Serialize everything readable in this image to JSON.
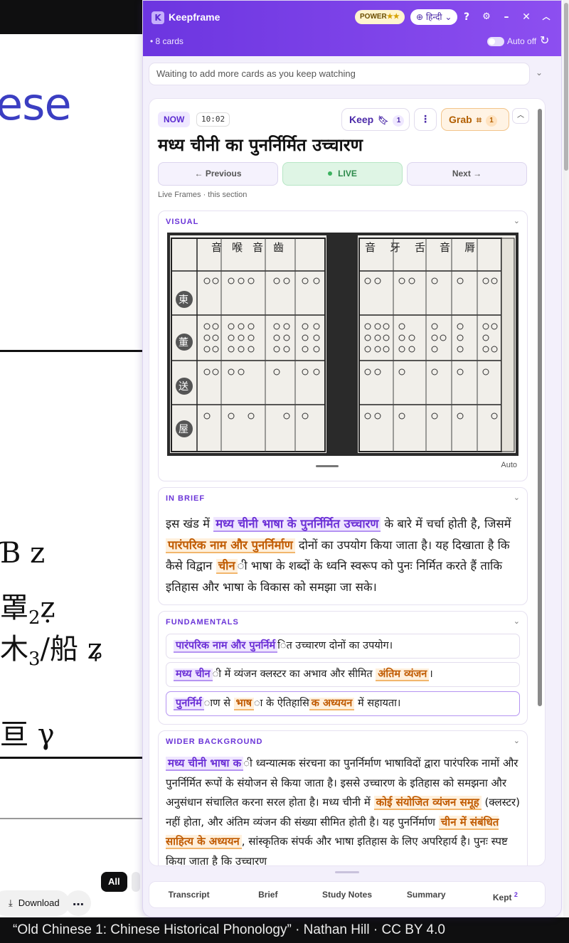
{
  "background": {
    "heading_fragment": "ese",
    "han_lines": [
      {
        "char": "Ɓ",
        "roman": "z"
      },
      {
        "char": "罩",
        "sub": "2",
        "roman": "ẓ"
      },
      {
        "char": "木",
        "sub": "3",
        "roman": "/船 ʑ"
      },
      {
        "char": "亘",
        "roman": "γ"
      }
    ],
    "chip_all": "All",
    "download_label": "Download",
    "caption": "“Old Chinese 1: Chinese Historical Phonology” · Nathan Hill · CC BY 4.0"
  },
  "header": {
    "logo_letter": "K",
    "brand": "Keepframe",
    "power_label": "POWER",
    "power_stars": "★★",
    "language": "⊕ हिन्दी ⌄",
    "cards_count": "• 8 cards",
    "auto_label": "Auto off"
  },
  "waiting_text": "Waiting to add more cards as you keep watching",
  "card": {
    "now_label": "NOW",
    "timestamp": "10:02",
    "keep_label": "Keep",
    "keep_count": "1",
    "grab_label": "Grab",
    "grab_count": "1",
    "title": "मध्य चीनी का पुनर्निर्मित उच्चारण",
    "prev_label": "← Previous",
    "live_label": "LIVE",
    "next_label": "Next →",
    "live_frames": "Live Frames · this section",
    "visual": {
      "label": "VISUAL",
      "auto": "Auto",
      "right_page_heads": [
        "音",
        "牙",
        "舌",
        "音",
        "脣"
      ],
      "left_page_heads": [
        "齒",
        "音",
        "喉",
        "音",
        "齒"
      ],
      "row_chars": [
        "東",
        "董",
        "送",
        "屋"
      ]
    },
    "brief": {
      "label": "IN BRIEF",
      "p1": "इस खंड में ",
      "h1": "मध्य चीनी भाषा के पुनर्निर्मित उच्चारण",
      "p2": " के बारे में चर्चा होती है, जिसमें ",
      "h2": "पारंपरिक नाम और पुनर्निर्माण",
      "p3": " दोनों का उपयोग किया जाता है। यह दिखाता है कि कैसे विद्वान ",
      "h3": "चीन",
      "p4": "ी भाषा के शब्दों के ध्वनि स्वरूप को पुनः निर्मित करते हैं ताकि इतिहास और भाषा के विकास को समझा जा सके।"
    },
    "fundamentals": {
      "label": "FUNDAMENTALS",
      "i1_h": "पारंपरिक नाम और पुनर्निर्म",
      "i1_t": "ित उच्चारण दोनों का उपयोग।",
      "i2_h": "मध्य चीन",
      "i2_t": "ी में व्यंजन क्लस्टर का अभाव और सीमित ",
      "i2_h2": "अंतिम व्यंजन",
      "i2_t2": "।",
      "i3_h": "पुनर्निर्म",
      "i3_t": "ाण से ",
      "i3_h2": "भाष",
      "i3_t2": "ा के ऐतिहासि",
      "i3_h3": "क अध्ययन",
      "i3_t3": " में सहायता।"
    },
    "wider": {
      "label": "WIDER BACKGROUND",
      "h1": "मध्य चीनी भाषा क",
      "t1": "ी ध्वन्यात्मक संरचना का पुनर्निर्माण भाषाविदों द्वारा पारंपरिक नामों और पुनर्निर्मित रूपों के संयोजन से किया जाता है। इससे उच्चारण के इतिहास को समझना और अनुसंधान संचालित करना सरल होता है। मध्य चीनी में ",
      "h2": "कोई संयोजित व्यंजन समूह",
      "t2": " (क्लस्टर) नहीं होता, और अंतिम व्यंजन की संख्या सीमित होती है। यह पुनर्निर्माण ",
      "h3": "चीन में संबंधित साहित्य के अध्ययन",
      "t3": ", सांस्कृतिक संपर्क और भाषा इतिहास के लिए अपरिहार्य है। पुनः स्पष्ट किया जाता है कि उच्चारण"
    }
  },
  "tabs": {
    "transcript": "Transcript",
    "brief": "Brief",
    "study_notes": "Study Notes",
    "summary": "Summary",
    "kept": "Kept",
    "kept_count": "2"
  },
  "colors": {
    "header_start": "#6c35e0",
    "header_end": "#8d4ff0",
    "accent_purple": "#6b35d8",
    "accent_orange": "#c05a00",
    "live_green": "#2e8b4c"
  }
}
